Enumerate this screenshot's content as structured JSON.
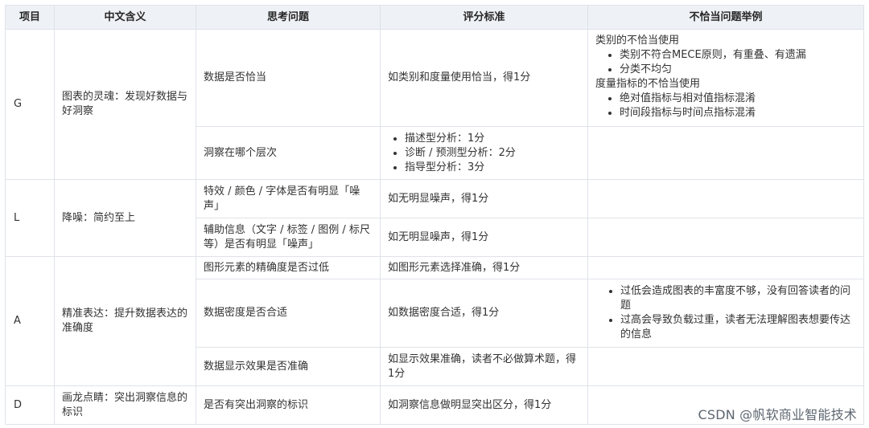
{
  "headers": [
    "项目",
    "中文含义",
    "思考问题",
    "评分标准",
    "不恰当问题举例"
  ],
  "groups": {
    "g": {
      "code": "G",
      "meaning": "图表的灵魂：发现好数据与好洞察",
      "rows": [
        {
          "question": "数据是否恰当",
          "criteria": "如类别和度量使用恰当，得1分",
          "examples": {
            "heading1": "类别的不恰当使用",
            "list1": [
              "类别不符合MECE原则，有重叠、有遗漏",
              "分类不均匀"
            ],
            "heading2": "度量指标的不恰当使用",
            "list2": [
              "绝对值指标与相对值指标混淆",
              "时间段指标与时间点指标混淆"
            ]
          }
        },
        {
          "question": "洞察在哪个层次",
          "criteria_list": [
            "描述型分析：1分",
            "诊断 / 预测型分析：2分",
            "指导型分析：3分"
          ]
        }
      ]
    },
    "l": {
      "code": "L",
      "meaning": "降噪：简约至上",
      "rows": [
        {
          "question": "特效 / 颜色 / 字体是否有明显「噪声」",
          "criteria": "如无明显噪声，得1分"
        },
        {
          "question": "辅助信息（文字 / 标签 / 图例 / 标尺等）是否有明显「噪声」",
          "criteria": "如无明显噪声，得1分"
        }
      ]
    },
    "a": {
      "code": "A",
      "meaning": "精准表达：提升数据表达的准确度",
      "rows": [
        {
          "question": "图形元素的精确度是否过低",
          "criteria": "如图形元素选择准确，得1分"
        },
        {
          "question": "数据密度是否合适",
          "criteria": "如数据密度合适，得1分",
          "examples_list": [
            "过低会造成图表的丰富度不够，没有回答读者的问题",
            "过高会导致负载过重，读者无法理解图表想要传达的信息"
          ]
        },
        {
          "question": "数据显示效果是否准确",
          "criteria": "如显示效果准确，读者不必做算术题，得1分"
        }
      ]
    },
    "d": {
      "code": "D",
      "meaning": "画龙点睛：突出洞察信息的标识",
      "rows": [
        {
          "question": "是否有突出洞察的标识",
          "criteria": "如洞察信息做明显突出区分，得1分"
        }
      ]
    }
  },
  "watermark": "CSDN @帆软商业智能技术"
}
